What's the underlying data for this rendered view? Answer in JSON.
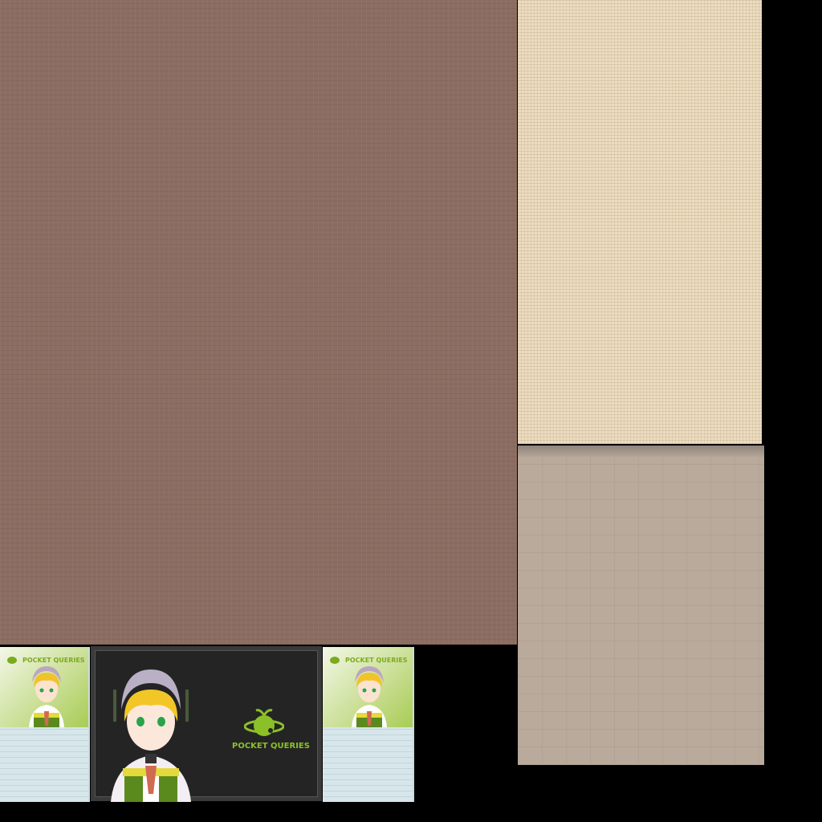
{
  "textures": {
    "wall": {
      "color": "#8b6d62"
    },
    "fabric": {
      "color": "#ecdcc0"
    },
    "panel": {
      "color": "#b9aa9c"
    }
  },
  "poster": {
    "brand": "POCKET QUERIES",
    "accent": "#7aab1e"
  },
  "screen": {
    "brand": "POCKET QUERIES",
    "accent": "#8cc028"
  }
}
